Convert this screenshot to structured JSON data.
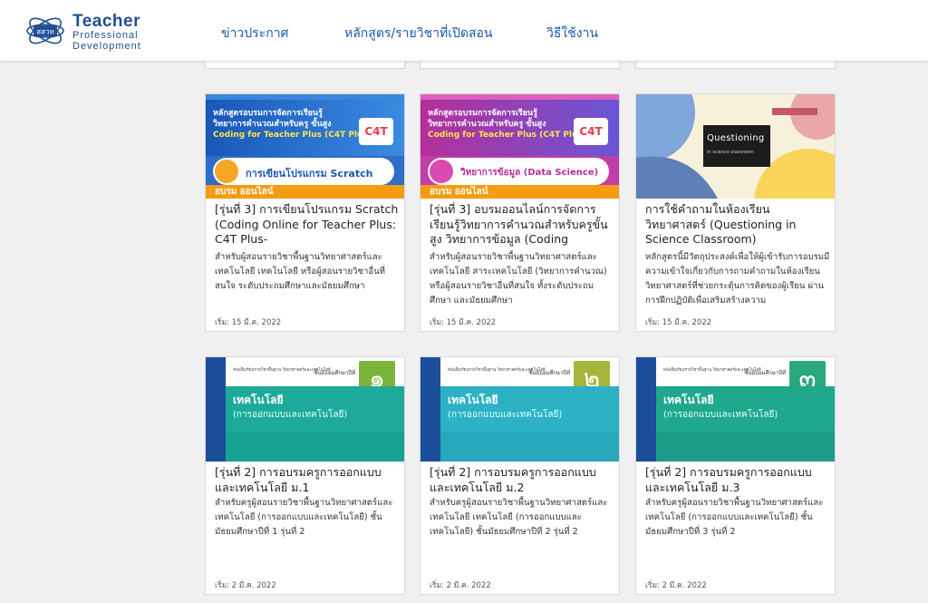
{
  "header": {
    "logo": {
      "emblem": "สสวท",
      "line1": "Teacher",
      "line2": "Professional",
      "line3": "Development"
    },
    "nav": [
      {
        "label": "ข่าวประกาศ"
      },
      {
        "label": "หลักสูตร/รายวิชาที่เปิดสอน"
      },
      {
        "label": "วิธีใช้งาน"
      }
    ],
    "colors": {
      "brand": "#1f4f93",
      "nav": "#1e5aa8"
    }
  },
  "cards": [
    {
      "title": "[รุ่นที่ 3] การเขียนโปรแกรม Scratch (Coding Online for Teacher Plus: C4T Plus-",
      "description": "สำหรับผู้สอนรายวิชาพื้นฐานวิทยาศาสตร์และเทคโนโลยี เทคโนโลยี หรือผู้สอนรายวิชาอื่นที่สนใจ ระดับประถมศึกษาและมัธยมศึกษา",
      "date": "เริ่ม: 15 มี.ค. 2022",
      "thumb": {
        "line1": "หลักสูตรอบรมการจัดการเรียนรู้",
        "line2": "วิทยาการคำนวณสำหรับครู ขั้นสูง",
        "line3": "Coding for Teacher Plus (C4T Plus)",
        "logo": "C4T",
        "pill": "การเขียนโปรแกรม Scratch",
        "bottom": "อบรม ออนไลน์"
      }
    },
    {
      "title": "[รุ่นที่ 3] อบรมออนไลน์การจัดการเรียนรู้วิทยาการคำนวณสำหรับครูขั้นสูง วิทยาการข้อมูล (Coding",
      "description": "สำหรับผู้สอนรายวิชาพื้นฐานวิทยาศาสตร์และเทคโนโลยี สาระเทคโนโลยี (วิทยาการคำนวณ) หรือผู้สอนรายวิชาอื่นที่สนใจ ทั้งระดับประถมศึกษา และมัธยมศึกษา",
      "date": "เริ่ม: 15 มี.ค. 2022",
      "thumb": {
        "line1": "หลักสูตรอบรมการจัดการเรียนรู้",
        "line2": "วิทยาการคำนวณสำหรับครู ขั้นสูง",
        "line3": "Coding for Teacher Plus (C4T Plus)",
        "logo": "C4T",
        "pill": "วิทยาการข้อมูล (Data Science)",
        "bottom": "อบรม ออนไลน์"
      }
    },
    {
      "title": "การใช้คำถามในห้องเรียนวิทยาศาสตร์ (Questioning in Science Classroom)",
      "description": "หลักสูตรนี้มีวัตถุประสงค์เพื่อให้ผู้เข้ารับการอบรมมีความเข้าใจเกี่ยวกับการถามคำถามในห้องเรียนวิทยาศาสตร์ที่ช่วยกระตุ้นการคิดของผู้เรียน ผ่านการฝึกปฏิบัติเพื่อเสริมสร้างความ",
      "date": "เริ่ม: 15 มี.ค. 2022",
      "thumb": {
        "box_title": "Questioning",
        "box_sub": "in science classroom"
      }
    },
    {
      "title": "[รุ่นที่ 2] การอบรมครูการออกแบบและเทคโนโลยี ม.1",
      "description": "สำหรับครูผู้สอนรายวิชาพื้นฐานวิทยาศาสตร์และเทคโนโลยี (การออกแบบและเทคโนโลยี) ชั้นมัธยมศึกษาปีที่ 1 รุ่นที่ 2",
      "date": "เริ่ม: 2 มี.ค. 2022",
      "thumb": {
        "head": "หนังสือเรียนรายวิชาพื้นฐาน วิทยาศาสตร์และเทคโนโลยี",
        "grade_label": "ชั้นมัธยมศึกษาปีที่",
        "grade": "๑",
        "subject": "เทคโนโลยี",
        "subtitle": "(การออกแบบและเทคโนโลยี)"
      }
    },
    {
      "title": "[รุ่นที่ 2] การอบรมครูการออกแบบและเทคโนโลยี ม.2",
      "description": "สำหรับครูผู้สอนรายวิชาพื้นฐานวิทยาศาสตร์และเทคโนโลยี เทคโนโลยี (การออกแบบและเทคโนโลยี) ชั้นมัธยมศึกษาปีที่ 2 รุ่นที่ 2",
      "date": "เริ่ม: 2 มี.ค. 2022",
      "thumb": {
        "head": "หนังสือเรียนรายวิชาพื้นฐาน วิทยาศาสตร์และเทคโนโลยี",
        "grade_label": "ชั้นมัธยมศึกษาปีที่",
        "grade": "๒",
        "subject": "เทคโนโลยี",
        "subtitle": "(การออกแบบและเทคโนโลยี)"
      }
    },
    {
      "title": "[รุ่นที่ 2] การอบรมครูการออกแบบและเทคโนโลยี ม.3",
      "description": "สำหรับครูผู้สอนรายวิชาพื้นฐานวิทยาศาสตร์และเทคโนโลยี (การออกแบบและเทคโนโลยี) ชั้นมัธยมศึกษาปีที่ 3 รุ่นที่ 2",
      "date": "เริ่ม: 2 มี.ค. 2022",
      "thumb": {
        "head": "หนังสือเรียนรายวิชาพื้นฐาน วิทยาศาสตร์และเทคโนโลยี",
        "grade_label": "ชั้นมัธยมศึกษาปีที่",
        "grade": "๓",
        "subject": "เทคโนโลยี",
        "subtitle": "(การออกแบบและเทคโนโลยี)"
      }
    }
  ]
}
